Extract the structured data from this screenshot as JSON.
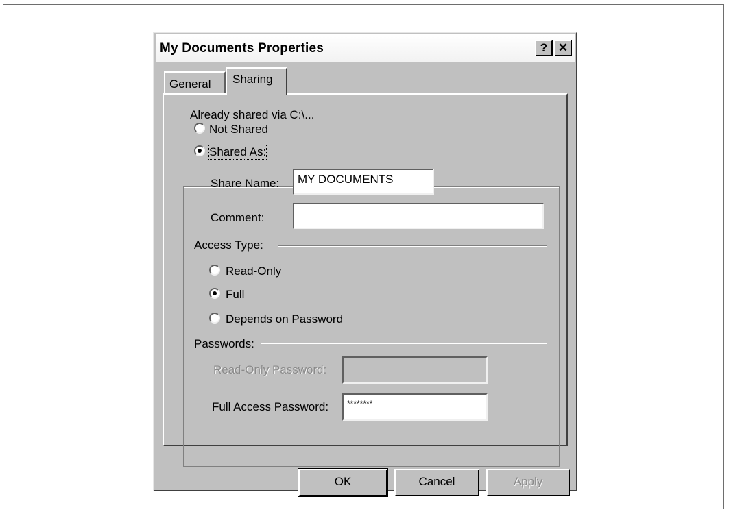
{
  "window": {
    "title": "My Documents Properties",
    "help_label": "?",
    "close_label": "✕"
  },
  "tabs": [
    {
      "label": "General",
      "selected": false
    },
    {
      "label": "Sharing",
      "selected": true
    }
  ],
  "sharing": {
    "status_text": "Already shared via C:\\...",
    "not_shared_label": "Not Shared",
    "shared_as_label": "Shared As:",
    "share_name_label": "Share Name:",
    "share_name_value": "MY DOCUMENTS",
    "comment_label": "Comment:",
    "comment_value": "",
    "access_type_label": "Access Type:",
    "access_options": {
      "read_only": "Read-Only",
      "full": "Full",
      "depends": "Depends on Password"
    },
    "passwords_label": "Passwords:",
    "read_only_password_label": "Read-Only Password:",
    "read_only_password_value": "",
    "full_access_password_label": "Full Access Password:",
    "full_access_password_value": "********"
  },
  "buttons": {
    "ok": "OK",
    "cancel": "Cancel",
    "apply": "Apply"
  },
  "colors": {
    "dialog_face": "#c0c0c0",
    "disabled_text": "#8a8a8a"
  }
}
